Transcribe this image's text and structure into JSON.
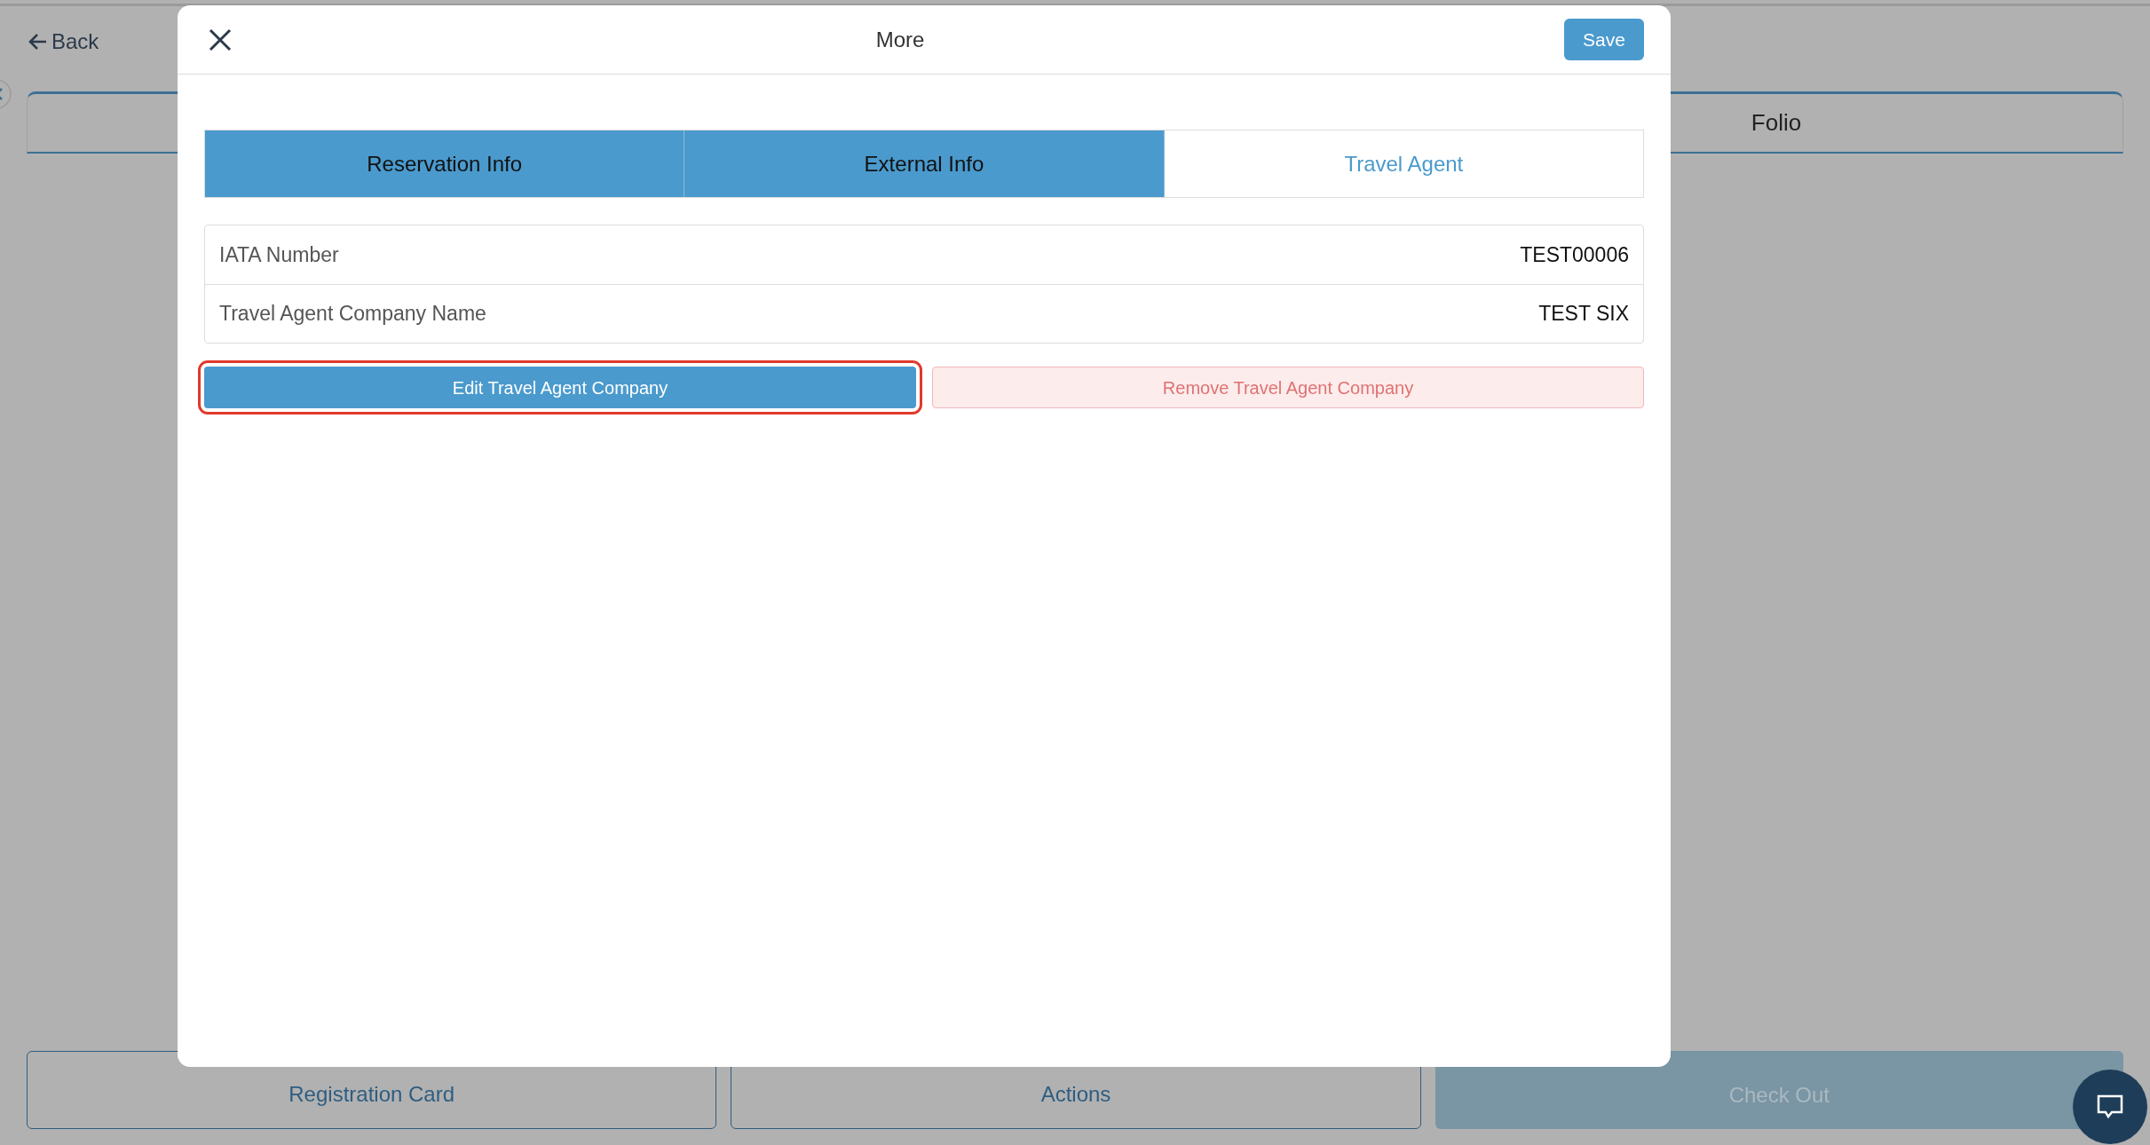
{
  "background": {
    "back_link": "Back",
    "folio_tab": "Folio",
    "bottom_buttons": [
      {
        "label": "Registration Card",
        "kind": "outline"
      },
      {
        "label": "Actions",
        "kind": "outline"
      },
      {
        "label": "Check Out",
        "kind": "filled"
      }
    ]
  },
  "modal": {
    "title": "More",
    "save_button": "Save",
    "tabs": [
      {
        "label": "Reservation Info",
        "selected": false
      },
      {
        "label": "External Info",
        "selected": false
      },
      {
        "label": "Travel Agent",
        "selected": true
      }
    ],
    "fields": [
      {
        "label": "IATA Number",
        "value": "TEST00006"
      },
      {
        "label": "Travel Agent Company Name",
        "value": "TEST SIX"
      }
    ],
    "actions": [
      {
        "label": "Edit Travel Agent Company",
        "kind": "primary",
        "highlighted": true
      },
      {
        "label": "Remove Travel Agent Company",
        "kind": "danger",
        "highlighted": false
      }
    ]
  }
}
